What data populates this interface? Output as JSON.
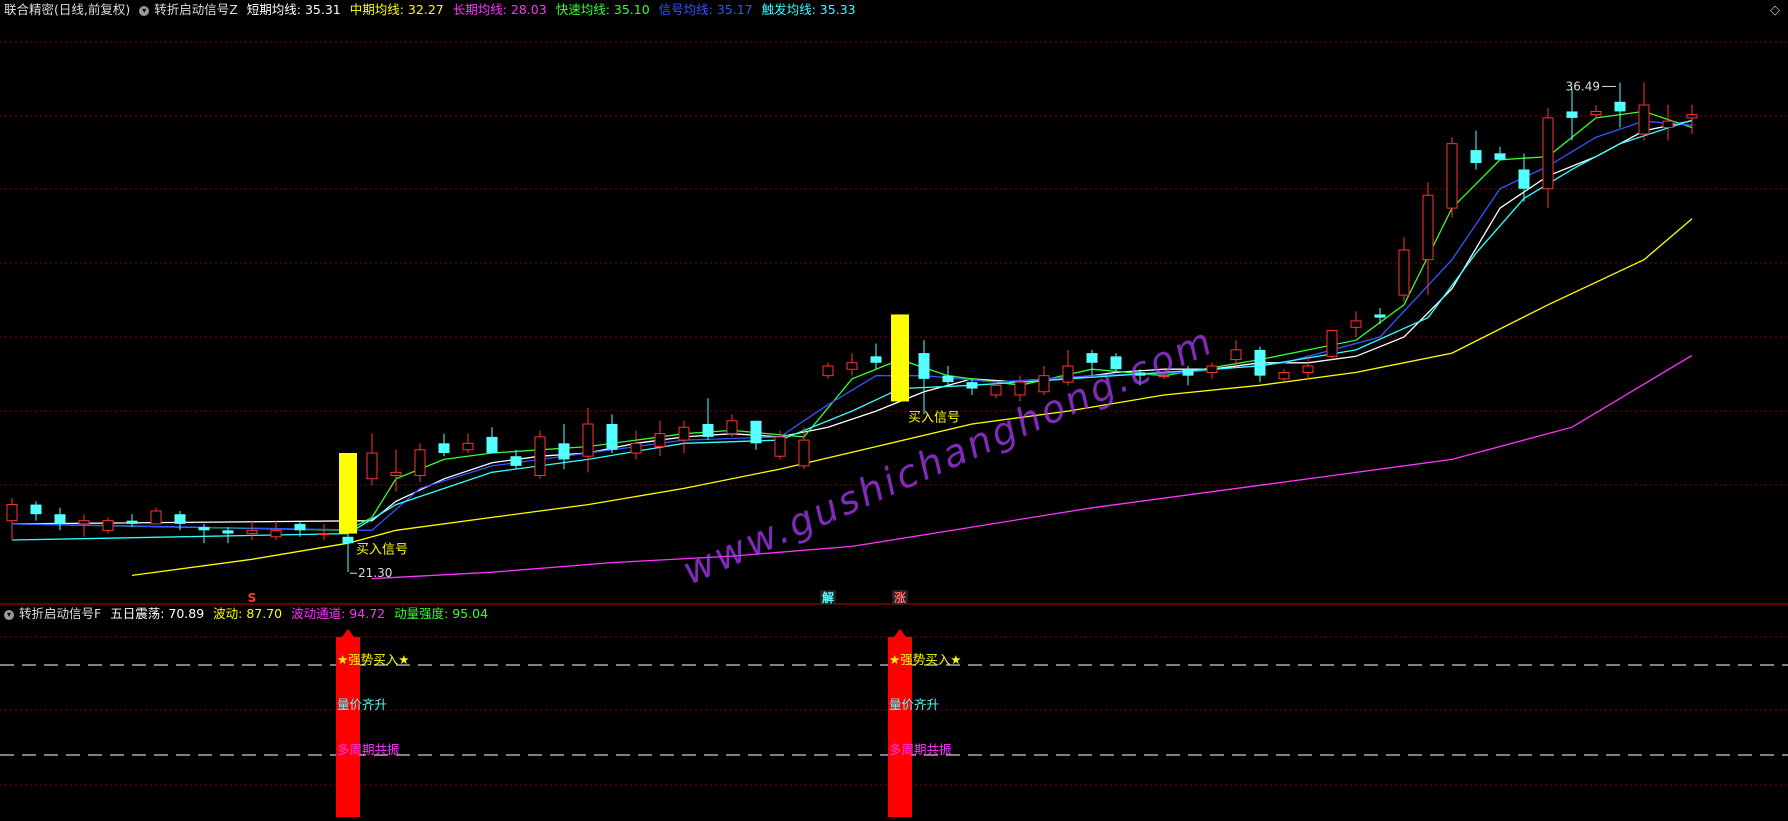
{
  "top_panel": {
    "title": "联合精密(日线,前复权)",
    "indicator": "转折启动信号Z",
    "legend": [
      {
        "label": "短期均线: 35.31",
        "color": "#ffffff"
      },
      {
        "label": "中期均线: 32.27",
        "color": "#ffff00"
      },
      {
        "label": "长期均线: 28.03",
        "color": "#ff33ff"
      },
      {
        "label": "快速均线: 35.10",
        "color": "#33ff33"
      },
      {
        "label": "信号均线: 35.17",
        "color": "#3355ff"
      },
      {
        "label": "触发均线: 35.33",
        "color": "#33ffff"
      }
    ],
    "diamond_icon": "◇"
  },
  "bottom_panel": {
    "indicator": "转折启动信号F",
    "legend": [
      {
        "label": "五日震荡: 70.89",
        "color": "#ffffff"
      },
      {
        "label": "波动: 87.70",
        "color": "#ffff00"
      },
      {
        "label": "波动通道: 94.72",
        "color": "#ff33ff"
      },
      {
        "label": "动量强度: 95.04",
        "color": "#33ff33"
      }
    ]
  },
  "watermark": "www.gushichanghong.com",
  "colors": {
    "up": "#ff3333",
    "down": "#54ffff",
    "grid": "#8b0000",
    "signal": "#ffff00",
    "bar": "#ff0000"
  },
  "chart_data": [
    {
      "type": "candlestick",
      "ylim": [
        20.5,
        38.5
      ],
      "max_label": "36.49",
      "min_label": "21.30",
      "ohlc": [
        [
          22.9,
          23.6,
          22.3,
          23.4
        ],
        [
          23.4,
          23.5,
          22.9,
          23.1
        ],
        [
          23.1,
          23.3,
          22.6,
          22.8
        ],
        [
          22.8,
          23.1,
          22.4,
          22.9
        ],
        [
          22.6,
          23.0,
          22.5,
          22.9
        ],
        [
          22.9,
          23.1,
          22.7,
          22.8
        ],
        [
          22.8,
          23.3,
          22.8,
          23.2
        ],
        [
          23.1,
          23.2,
          22.6,
          22.8
        ],
        [
          22.7,
          22.8,
          22.2,
          22.6
        ],
        [
          22.6,
          22.7,
          22.2,
          22.5
        ],
        [
          22.5,
          22.9,
          22.3,
          22.6
        ],
        [
          22.4,
          22.9,
          22.3,
          22.6
        ],
        [
          22.8,
          22.9,
          22.4,
          22.6
        ],
        [
          22.5,
          22.8,
          22.3,
          22.5
        ],
        [
          22.4,
          22.6,
          21.3,
          22.2
        ],
        [
          24.2,
          25.6,
          24.0,
          25.0
        ],
        [
          24.3,
          25.1,
          23.8,
          24.4
        ],
        [
          24.3,
          25.3,
          24.1,
          25.1
        ],
        [
          25.3,
          25.6,
          24.9,
          25.0
        ],
        [
          25.1,
          25.6,
          25.0,
          25.3
        ],
        [
          25.5,
          25.8,
          25.0,
          25.0
        ],
        [
          24.9,
          25.1,
          24.5,
          24.6
        ],
        [
          24.3,
          25.7,
          24.2,
          25.5
        ],
        [
          25.3,
          25.9,
          24.5,
          24.8
        ],
        [
          24.9,
          26.4,
          24.4,
          25.9
        ],
        [
          25.9,
          26.2,
          25.0,
          25.1
        ],
        [
          25.0,
          25.7,
          24.8,
          25.3
        ],
        [
          25.2,
          26.0,
          24.9,
          25.6
        ],
        [
          25.4,
          26.0,
          25.0,
          25.8
        ],
        [
          25.9,
          26.7,
          25.4,
          25.5
        ],
        [
          25.6,
          26.2,
          25.5,
          26.0
        ],
        [
          26.0,
          26.0,
          25.1,
          25.3
        ],
        [
          24.9,
          25.7,
          24.8,
          25.5
        ],
        [
          24.6,
          25.8,
          24.5,
          25.4
        ],
        [
          27.4,
          27.8,
          27.3,
          27.7
        ],
        [
          27.6,
          28.1,
          27.4,
          27.8
        ],
        [
          28.0,
          28.4,
          27.6,
          27.8
        ],
        [
          28.2,
          28.8,
          27.5,
          28.0
        ],
        [
          28.1,
          28.5,
          26.2,
          27.3
        ],
        [
          27.4,
          27.7,
          27.1,
          27.2
        ],
        [
          27.2,
          27.3,
          26.8,
          27.0
        ],
        [
          26.8,
          27.2,
          26.7,
          27.1
        ],
        [
          26.8,
          27.4,
          26.6,
          27.2
        ],
        [
          26.9,
          27.7,
          26.8,
          27.4
        ],
        [
          27.2,
          28.2,
          27.1,
          27.7
        ],
        [
          28.1,
          28.2,
          27.4,
          27.8
        ],
        [
          28.0,
          28.1,
          27.5,
          27.6
        ],
        [
          27.5,
          27.6,
          27.1,
          27.4
        ],
        [
          27.4,
          27.6,
          27.3,
          27.4
        ],
        [
          27.6,
          27.7,
          27.1,
          27.4
        ],
        [
          27.5,
          27.8,
          27.3,
          27.7
        ],
        [
          27.9,
          28.5,
          27.7,
          28.2
        ],
        [
          28.2,
          28.3,
          27.2,
          27.4
        ],
        [
          27.3,
          27.6,
          27.2,
          27.5
        ],
        [
          27.5,
          28.0,
          27.3,
          27.7
        ],
        [
          28.0,
          28.8,
          27.9,
          28.8
        ],
        [
          28.9,
          29.4,
          28.6,
          29.1
        ],
        [
          29.3,
          29.5,
          29.0,
          29.2
        ],
        [
          29.9,
          31.7,
          29.7,
          31.3
        ],
        [
          31.0,
          33.4,
          29.9,
          33.0
        ],
        [
          32.6,
          34.8,
          32.3,
          34.6
        ],
        [
          34.4,
          35.0,
          33.8,
          34.0
        ],
        [
          34.3,
          34.5,
          34.1,
          34.1
        ],
        [
          33.8,
          34.3,
          32.8,
          33.2
        ],
        [
          33.2,
          35.7,
          32.6,
          35.4
        ],
        [
          35.6,
          36.3,
          34.7,
          35.4
        ],
        [
          35.5,
          35.8,
          35.4,
          35.6
        ],
        [
          35.9,
          36.5,
          35.1,
          35.6
        ],
        [
          34.9,
          36.5,
          34.7,
          35.8
        ],
        [
          35.1,
          35.8,
          34.7,
          35.3
        ],
        [
          35.4,
          35.8,
          34.9,
          35.5
        ]
      ],
      "lines": [
        {
          "name": "短期均线",
          "color": "#ffffff",
          "values": [
            [
              0,
              22.8
            ],
            [
              15,
              22.9
            ],
            [
              16,
              23.5
            ],
            [
              18,
              24.2
            ],
            [
              20,
              24.7
            ],
            [
              22,
              24.9
            ],
            [
              24,
              25.0
            ],
            [
              26,
              25.3
            ],
            [
              28,
              25.5
            ],
            [
              30,
              25.6
            ],
            [
              32,
              25.5
            ],
            [
              34,
              25.8
            ],
            [
              36,
              26.3
            ],
            [
              38,
              26.9
            ],
            [
              40,
              27.3
            ],
            [
              42,
              27.2
            ],
            [
              44,
              27.3
            ],
            [
              46,
              27.5
            ],
            [
              48,
              27.6
            ],
            [
              50,
              27.6
            ],
            [
              52,
              27.8
            ],
            [
              54,
              27.8
            ],
            [
              56,
              28.0
            ],
            [
              58,
              28.6
            ],
            [
              60,
              30.1
            ],
            [
              62,
              32.6
            ],
            [
              64,
              33.6
            ],
            [
              66,
              34.2
            ],
            [
              68,
              35.0
            ],
            [
              70,
              35.31
            ]
          ]
        },
        {
          "name": "中期均线",
          "color": "#ffff00",
          "values": [
            [
              5,
              21.2
            ],
            [
              10,
              21.7
            ],
            [
              14,
              22.2
            ],
            [
              16,
              22.6
            ],
            [
              20,
              23.0
            ],
            [
              24,
              23.4
            ],
            [
              28,
              23.9
            ],
            [
              32,
              24.5
            ],
            [
              36,
              25.2
            ],
            [
              40,
              25.9
            ],
            [
              44,
              26.3
            ],
            [
              48,
              26.8
            ],
            [
              52,
              27.1
            ],
            [
              56,
              27.5
            ],
            [
              60,
              28.1
            ],
            [
              64,
              29.6
            ],
            [
              68,
              31.0
            ],
            [
              70,
              32.27
            ]
          ]
        },
        {
          "name": "长期均线",
          "color": "#ff33ff",
          "values": [
            [
              15,
              21.1
            ],
            [
              20,
              21.3
            ],
            [
              25,
              21.6
            ],
            [
              30,
              21.8
            ],
            [
              35,
              22.1
            ],
            [
              40,
              22.7
            ],
            [
              45,
              23.3
            ],
            [
              50,
              23.8
            ],
            [
              55,
              24.3
            ],
            [
              60,
              24.8
            ],
            [
              65,
              25.8
            ],
            [
              70,
              28.03
            ]
          ]
        },
        {
          "name": "快速均线",
          "color": "#33ff33",
          "values": [
            [
              0,
              22.8
            ],
            [
              14,
              22.6
            ],
            [
              15,
              23.0
            ],
            [
              16,
              24.2
            ],
            [
              18,
              24.8
            ],
            [
              20,
              25.0
            ],
            [
              24,
              25.2
            ],
            [
              28,
              25.6
            ],
            [
              30,
              25.7
            ],
            [
              33,
              25.5
            ],
            [
              35,
              27.3
            ],
            [
              37,
              27.9
            ],
            [
              39,
              27.4
            ],
            [
              42,
              27.1
            ],
            [
              45,
              27.6
            ],
            [
              48,
              27.4
            ],
            [
              52,
              27.9
            ],
            [
              56,
              28.5
            ],
            [
              58,
              29.6
            ],
            [
              60,
              32.6
            ],
            [
              62,
              34.1
            ],
            [
              64,
              34.2
            ],
            [
              66,
              35.4
            ],
            [
              68,
              35.6
            ],
            [
              70,
              35.1
            ]
          ]
        },
        {
          "name": "信号均线",
          "color": "#3355ff",
          "values": [
            [
              0,
              22.8
            ],
            [
              15,
              22.6
            ],
            [
              17,
              23.9
            ],
            [
              20,
              24.6
            ],
            [
              24,
              25.0
            ],
            [
              28,
              25.4
            ],
            [
              32,
              25.5
            ],
            [
              34,
              26.5
            ],
            [
              36,
              27.4
            ],
            [
              38,
              27.4
            ],
            [
              41,
              27.2
            ],
            [
              45,
              27.4
            ],
            [
              49,
              27.5
            ],
            [
              53,
              27.8
            ],
            [
              57,
              28.6
            ],
            [
              60,
              31.0
            ],
            [
              62,
              33.2
            ],
            [
              64,
              33.9
            ],
            [
              66,
              34.8
            ],
            [
              68,
              35.3
            ],
            [
              70,
              35.17
            ]
          ]
        },
        {
          "name": "触发均线",
          "color": "#33ffff",
          "values": [
            [
              0,
              22.3
            ],
            [
              14,
              22.5
            ],
            [
              16,
              23.4
            ],
            [
              20,
              24.4
            ],
            [
              24,
              24.8
            ],
            [
              28,
              25.3
            ],
            [
              32,
              25.4
            ],
            [
              35,
              26.3
            ],
            [
              37,
              27.0
            ],
            [
              40,
              27.1
            ],
            [
              44,
              27.3
            ],
            [
              48,
              27.5
            ],
            [
              52,
              27.7
            ],
            [
              56,
              28.2
            ],
            [
              59,
              29.2
            ],
            [
              61,
              31.2
            ],
            [
              63,
              32.9
            ],
            [
              65,
              33.8
            ],
            [
              67,
              34.6
            ],
            [
              70,
              35.33
            ]
          ]
        }
      ],
      "signals": [
        {
          "index": 14,
          "from": 22.5,
          "to": 25.0,
          "label": "买入信号"
        },
        {
          "index": 37,
          "from": 26.6,
          "to": 29.3,
          "label": "买入信号"
        }
      ],
      "markers": [
        {
          "index": 10,
          "text": "S",
          "color": "#ff3333"
        },
        {
          "index": 34,
          "text": "解",
          "color": "#54ffff"
        },
        {
          "index": 37,
          "text": "涨",
          "color": "#ff6666"
        }
      ]
    },
    {
      "type": "bar",
      "signals": [
        {
          "index": 14,
          "texts": [
            "★强势买入★",
            "量价齐升",
            "多周期共振"
          ]
        },
        {
          "index": 37,
          "texts": [
            "★强势买入★",
            "量价齐升",
            "多周期共振"
          ]
        }
      ],
      "text_colors": [
        "#ffff00",
        "#54ffff",
        "#ff33ff"
      ]
    }
  ]
}
